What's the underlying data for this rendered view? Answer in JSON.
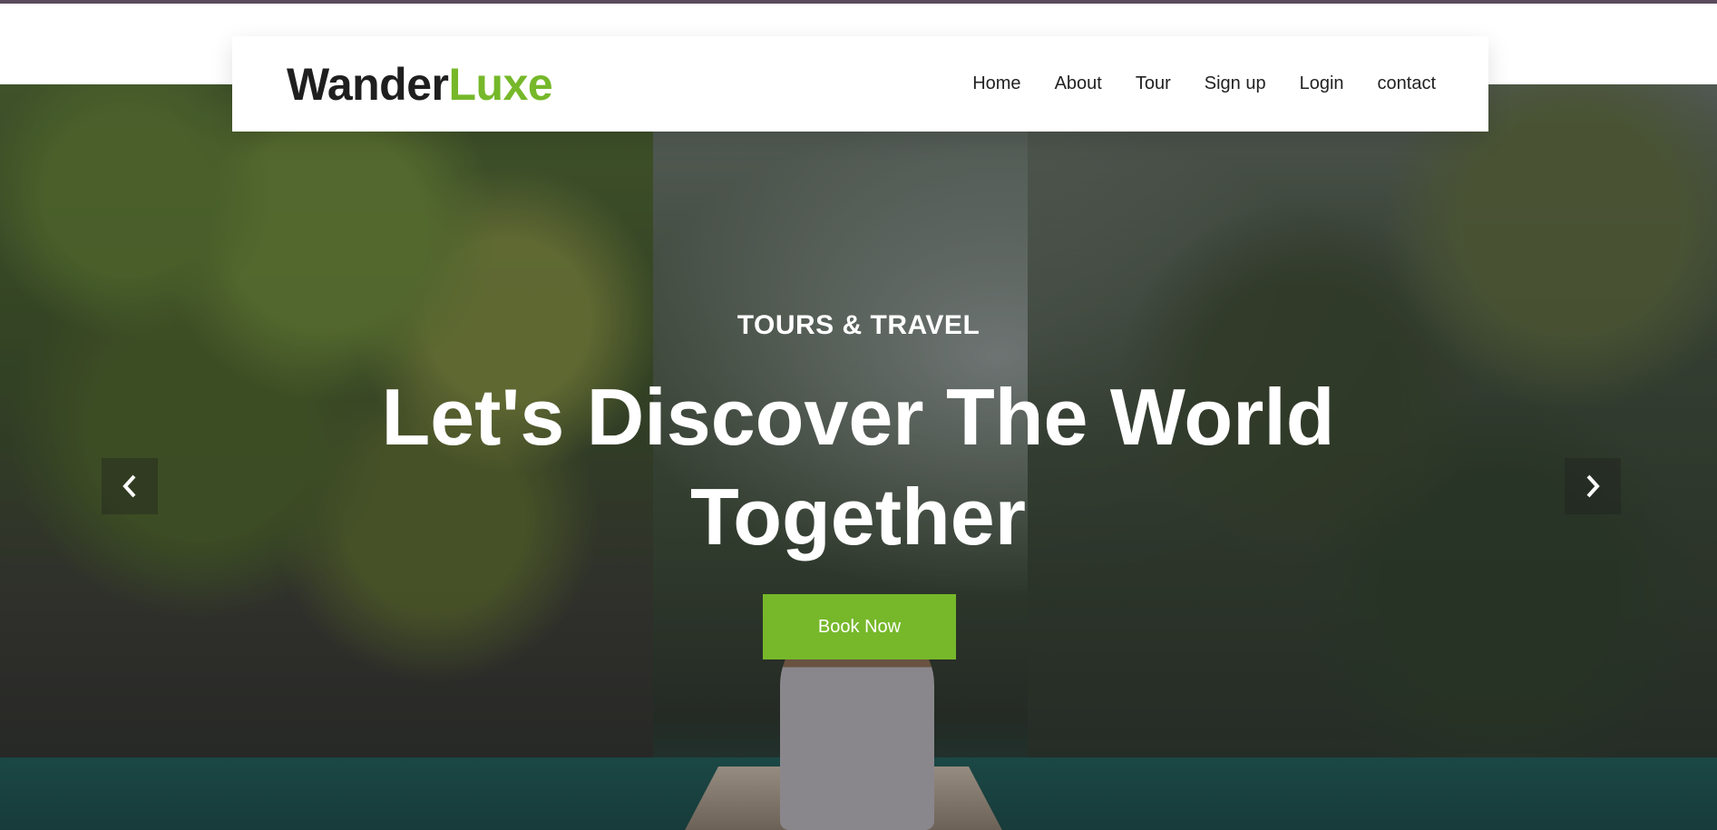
{
  "brand": {
    "name_part1": "Wander",
    "name_part2": "Luxe",
    "accent_color": "#76b82a",
    "dark_color": "#1f1f1f"
  },
  "nav": {
    "items": [
      {
        "label": "Home"
      },
      {
        "label": "About"
      },
      {
        "label": "Tour"
      },
      {
        "label": "Sign up"
      },
      {
        "label": "Login"
      },
      {
        "label": "contact"
      }
    ]
  },
  "hero": {
    "eyebrow": "TOURS & TRAVEL",
    "headline": "Let's Discover The World Together",
    "cta_label": "Book Now",
    "prev_icon": "chevron-left-icon",
    "next_icon": "chevron-right-icon"
  }
}
